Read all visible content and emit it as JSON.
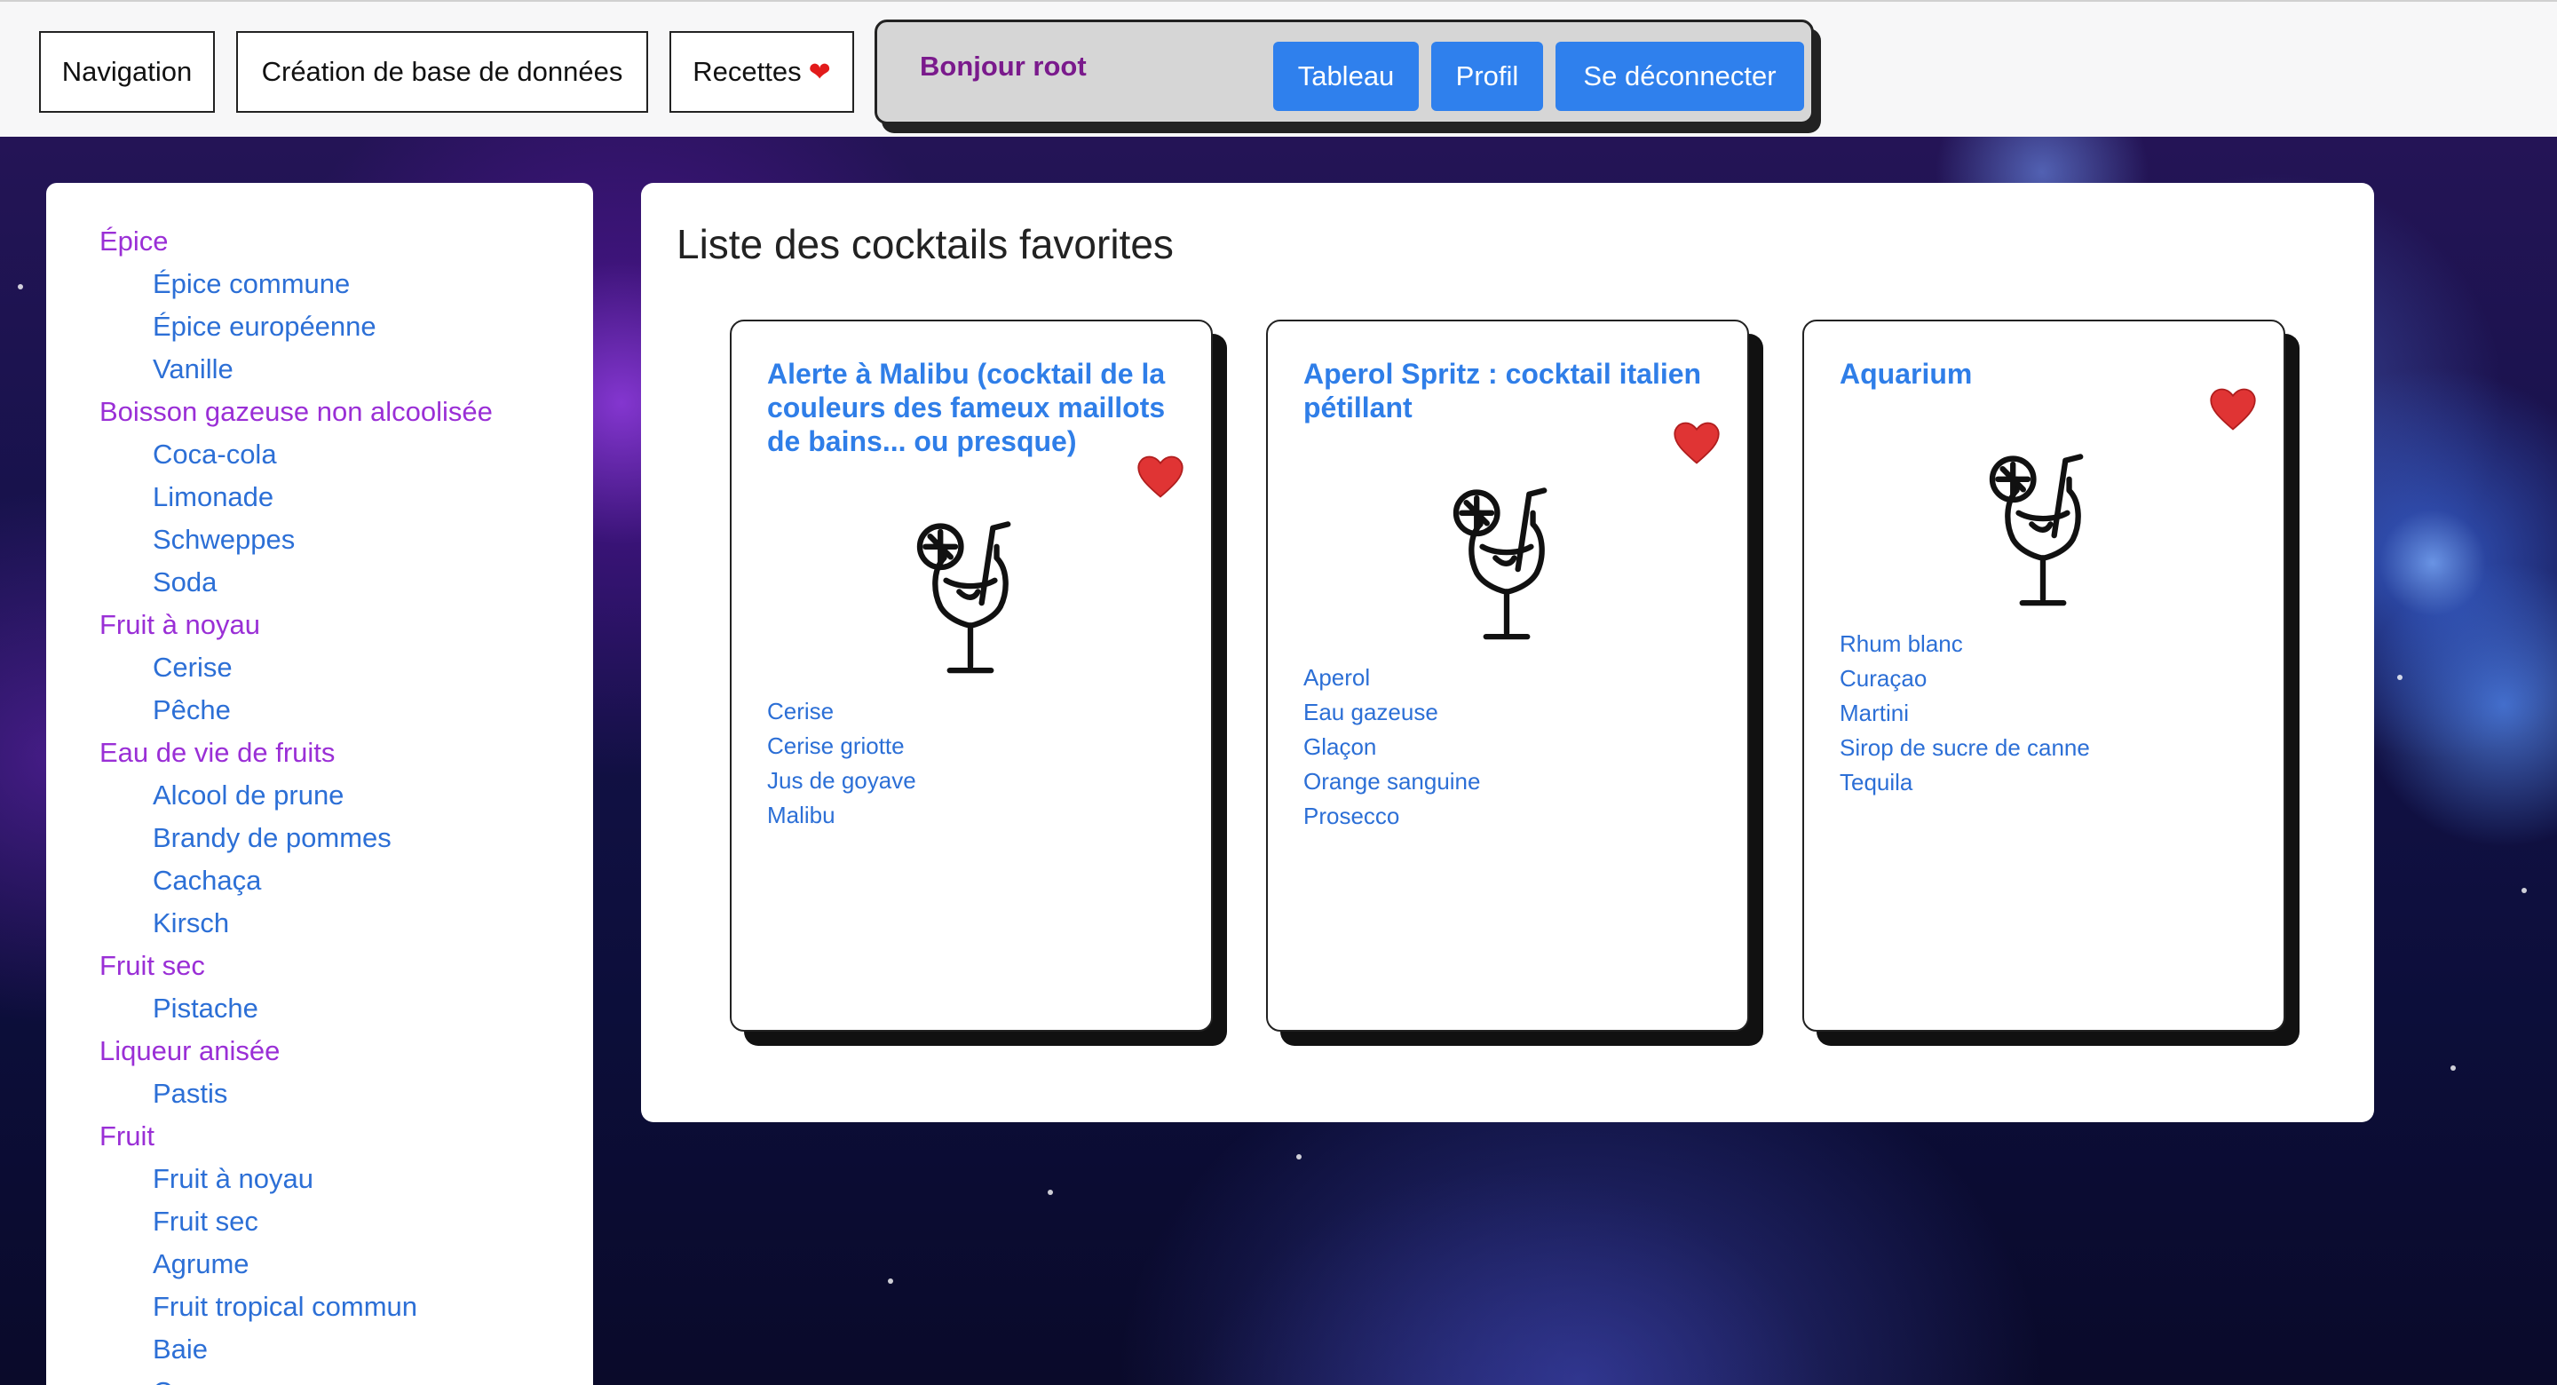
{
  "nav": {
    "navigation": "Navigation",
    "creation": "Création de base de données",
    "recettes": "Recettes",
    "recettes_icon": "heart-icon"
  },
  "user": {
    "greeting": "Bonjour root",
    "tableau": "Tableau",
    "profil": "Profil",
    "logout": "Se déconnecter"
  },
  "sidebar": {
    "items": [
      {
        "label": "Épice",
        "level": 0
      },
      {
        "label": "Épice commune",
        "level": 1
      },
      {
        "label": "Épice européenne",
        "level": 1
      },
      {
        "label": "Vanille",
        "level": 1
      },
      {
        "label": "Boisson gazeuse non alcoolisée",
        "level": 0
      },
      {
        "label": "Coca-cola",
        "level": 1
      },
      {
        "label": "Limonade",
        "level": 1
      },
      {
        "label": "Schweppes",
        "level": 1
      },
      {
        "label": "Soda",
        "level": 1
      },
      {
        "label": "Fruit à noyau",
        "level": 0
      },
      {
        "label": "Cerise",
        "level": 1
      },
      {
        "label": "Pêche",
        "level": 1
      },
      {
        "label": "Eau de vie de fruits",
        "level": 0
      },
      {
        "label": "Alcool de prune",
        "level": 1
      },
      {
        "label": "Brandy de pommes",
        "level": 1
      },
      {
        "label": "Cachaça",
        "level": 1
      },
      {
        "label": "Kirsch",
        "level": 1
      },
      {
        "label": "Fruit sec",
        "level": 0
      },
      {
        "label": "Pistache",
        "level": 1
      },
      {
        "label": "Liqueur anisée",
        "level": 0
      },
      {
        "label": "Pastis",
        "level": 1
      },
      {
        "label": "Fruit",
        "level": 0
      },
      {
        "label": "Fruit à noyau",
        "level": 1
      },
      {
        "label": "Fruit sec",
        "level": 1
      },
      {
        "label": "Agrume",
        "level": 1
      },
      {
        "label": "Fruit tropical commun",
        "level": 1
      },
      {
        "label": "Baie",
        "level": 1
      },
      {
        "label": "Courge",
        "level": 1
      }
    ]
  },
  "main": {
    "title": "Liste des cocktails favorites",
    "cards": [
      {
        "title": "Alerte à Malibu (cocktail de la couleurs des fameux maillots de bains... ou presque)",
        "favorite_icon": "heart-icon",
        "image_icon": "cocktail-glass-icon",
        "ingredients": [
          "Cerise",
          "Cerise griotte",
          "Jus de goyave",
          "Malibu"
        ]
      },
      {
        "title": "Aperol Spritz : cocktail italien pétillant",
        "favorite_icon": "heart-icon",
        "image_icon": "cocktail-glass-icon",
        "ingredients": [
          "Aperol",
          "Eau gazeuse",
          "Glaçon",
          "Orange sanguine",
          "Prosecco"
        ]
      },
      {
        "title": "Aquarium",
        "favorite_icon": "heart-icon",
        "image_icon": "cocktail-glass-icon",
        "ingredients": [
          "Rhum blanc",
          "Curaçao",
          "Martini",
          "Sirop de sucre de canne",
          "Tequila"
        ]
      }
    ]
  },
  "colors": {
    "accent": "#2f80ed",
    "category": "#9a2fd6",
    "link": "#2c6fd6",
    "greeting": "#7a1a8c",
    "heart": "#e21b1b"
  }
}
